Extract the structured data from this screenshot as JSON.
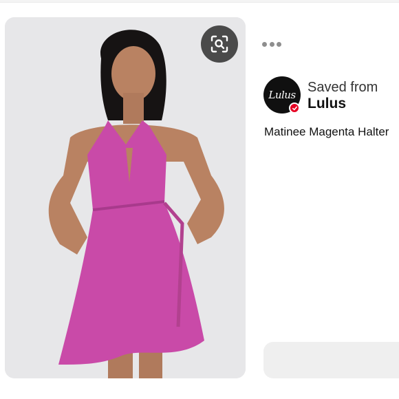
{
  "pin": {
    "image_alt": "Woman wearing a magenta halter wrap dress",
    "colors": {
      "dress": "#c94aa8",
      "background": "#e7e7e9"
    }
  },
  "actions": {
    "lens_icon": "visual-search-icon",
    "more_icon": "ellipsis-icon"
  },
  "source": {
    "avatar_text": "Lulus",
    "saved_label": "Saved from",
    "name": "Lulus",
    "verified_icon": "verified-check-icon",
    "badge_color": "#e60023"
  },
  "title": "Matinee Magenta Halter"
}
